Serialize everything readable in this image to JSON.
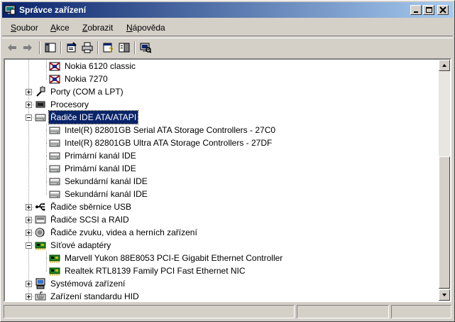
{
  "window": {
    "title": "Správce zařízení"
  },
  "menu": [
    {
      "label": "Soubor",
      "key": "S",
      "rest": "oubor"
    },
    {
      "label": "Akce",
      "key": "A",
      "rest": "kce"
    },
    {
      "label": "Zobrazit",
      "key": "Z",
      "rest": "obrazit"
    },
    {
      "label": "Nápověda",
      "key": "N",
      "rest": "ápověda"
    }
  ],
  "toolbar": [
    "back-arrow-icon",
    "forward-arrow-icon",
    "console-tree-icon",
    "properties-icon",
    "print-icon",
    "help-icon",
    "view-icon",
    "scan-hardware-icon"
  ],
  "tree": [
    {
      "label": "Nokia 6120 classic",
      "level": 2,
      "icon": "phone-modem-icon"
    },
    {
      "label": "Nokia 7270",
      "level": 2,
      "icon": "phone-modem-icon"
    },
    {
      "label": "Porty (COM a LPT)",
      "level": 1,
      "icon": "port-icon",
      "expander": "plus"
    },
    {
      "label": "Procesory",
      "level": 1,
      "icon": "processor-icon",
      "expander": "plus"
    },
    {
      "label": "Řadiče IDE ATA/ATAPI",
      "level": 1,
      "icon": "ide-controller-icon",
      "expander": "minus",
      "selected": true
    },
    {
      "label": "Intel(R) 82801GB Serial ATA Storage Controllers - 27C0",
      "level": 2,
      "icon": "ide-controller-icon"
    },
    {
      "label": "Intel(R) 82801GB Ultra ATA Storage Controllers - 27DF",
      "level": 2,
      "icon": "ide-controller-icon"
    },
    {
      "label": "Primární kanál IDE",
      "level": 2,
      "icon": "ide-controller-icon"
    },
    {
      "label": "Primární kanál IDE",
      "level": 2,
      "icon": "ide-controller-icon"
    },
    {
      "label": "Sekundární kanál IDE",
      "level": 2,
      "icon": "ide-controller-icon"
    },
    {
      "label": "Sekundární kanál IDE",
      "level": 2,
      "icon": "ide-controller-icon"
    },
    {
      "label": "Řadiče sběrnice USB",
      "level": 1,
      "icon": "usb-icon",
      "expander": "plus"
    },
    {
      "label": "Řadiče SCSI a RAID",
      "level": 1,
      "icon": "scsi-icon",
      "expander": "plus"
    },
    {
      "label": "Řadiče zvuku, videa a herních zařízení",
      "level": 1,
      "icon": "sound-icon",
      "expander": "plus"
    },
    {
      "label": "Síťové adaptéry",
      "level": 1,
      "icon": "network-adapter-icon",
      "expander": "minus"
    },
    {
      "label": "Marvell Yukon 88E8053 PCI-E Gigabit Ethernet Controller",
      "level": 2,
      "icon": "network-adapter-icon"
    },
    {
      "label": "Realtek RTL8139 Family PCI Fast Ethernet NIC",
      "level": 2,
      "icon": "network-adapter-icon"
    },
    {
      "label": "Systémová zařízení",
      "level": 1,
      "icon": "system-devices-icon",
      "expander": "plus"
    },
    {
      "label": "Zařízení standardu HID",
      "level": 1,
      "icon": "hid-icon",
      "expander": "plus"
    }
  ],
  "colors": {
    "titlebar_start": "#0a246a",
    "titlebar_end": "#a6caf0",
    "selection": "#0a246a",
    "face": "#d4d0c8"
  }
}
